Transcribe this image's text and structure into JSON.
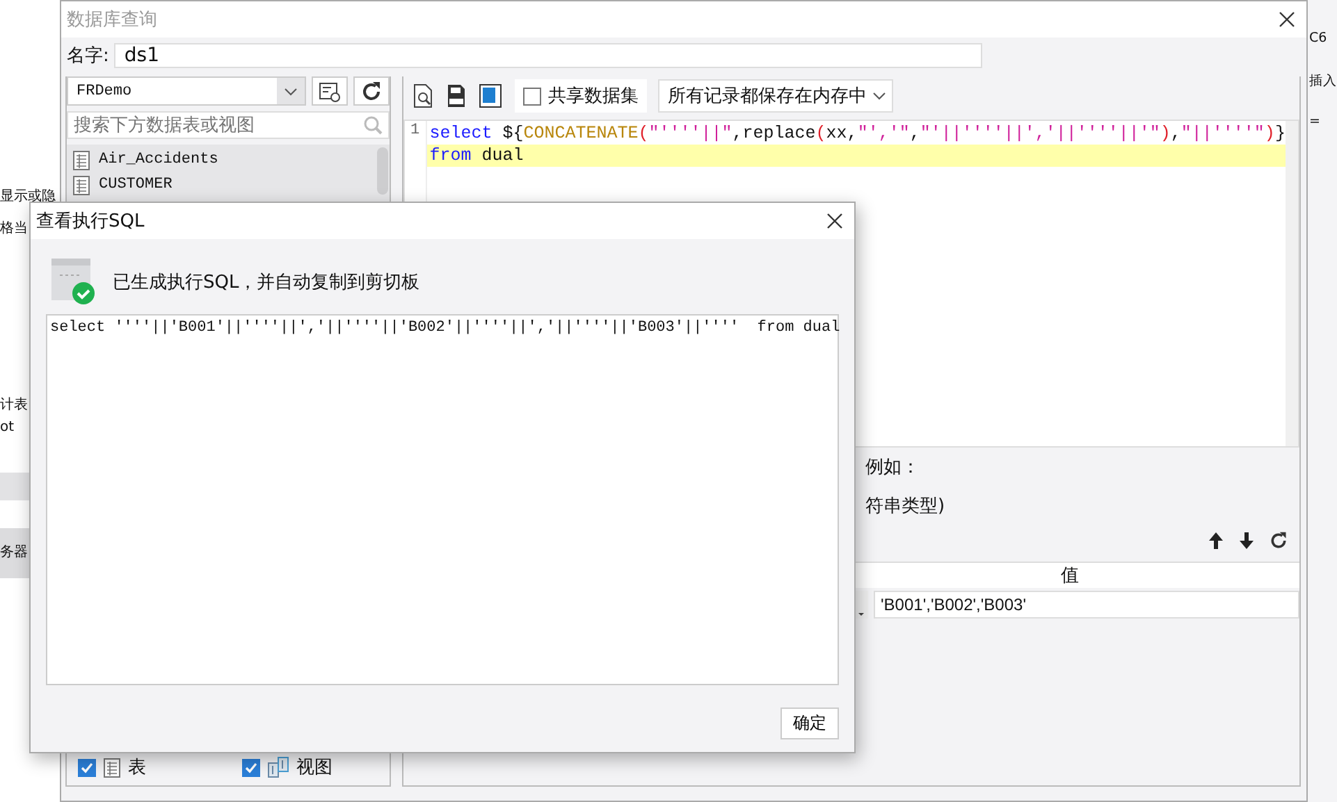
{
  "background": {
    "left_texts": [
      "显示或隐",
      "格当",
      "计表",
      "ot",
      "务器"
    ],
    "right_texts": [
      "C6",
      "插入",
      "="
    ]
  },
  "main_dialog": {
    "title": "数据库查询",
    "name_label": "名字:",
    "name_value": "ds1",
    "connection": "FRDemo",
    "search": {
      "placeholder": "搜索下方数据表或视图"
    },
    "tables": [
      {
        "name": "Air_Accidents"
      },
      {
        "name": "CUSTOMER"
      }
    ],
    "filters": [
      {
        "kind": "table",
        "label": "表",
        "checked": true
      },
      {
        "kind": "view",
        "label": "视图",
        "checked": true
      }
    ],
    "share_dataset": {
      "label": "共享数据集",
      "checked": false
    },
    "storage_mode": "所有记录都保存在内存中",
    "editor": {
      "lines": [
        {
          "number": "1",
          "highlighted": false,
          "tokens": [
            {
              "kind": "keyword",
              "text": "select"
            },
            {
              "kind": "plain",
              "text": " ${"
            },
            {
              "kind": "function",
              "text": "CONCATENATE"
            },
            {
              "kind": "paren",
              "text": "("
            },
            {
              "kind": "string",
              "text": "\"''''||\""
            },
            {
              "kind": "plain",
              "text": ",replace"
            },
            {
              "kind": "paren",
              "text": "("
            },
            {
              "kind": "plain",
              "text": "xx,"
            },
            {
              "kind": "string",
              "text": "\"','\""
            },
            {
              "kind": "plain",
              "text": ","
            },
            {
              "kind": "string",
              "text": "\"'||''''||','||''''||'\""
            },
            {
              "kind": "paren",
              "text": ")"
            },
            {
              "kind": "plain",
              "text": ","
            },
            {
              "kind": "string",
              "text": "\"||''''\""
            },
            {
              "kind": "paren",
              "text": ")"
            },
            {
              "kind": "plain",
              "text": "}"
            }
          ]
        },
        {
          "highlighted": true,
          "tokens": [
            {
              "kind": "keyword",
              "text": "from"
            },
            {
              "kind": "plain",
              "text": " dual"
            }
          ]
        }
      ]
    },
    "hint_texts": [
      "例如：",
      "符串类型)"
    ],
    "parameters": {
      "columns": [
        "值"
      ],
      "rows": [
        {
          "value": "'B001','B002','B003'"
        }
      ]
    }
  },
  "sql_dialog": {
    "title": "查看执行SQL",
    "message": "已生成执行SQL，并自动复制到剪切板",
    "sql": "select ''''||'B001'||''''||','||''''||'B002'||''''||','||''''||'B003'||''''  from dual",
    "ok_button": "确定"
  }
}
